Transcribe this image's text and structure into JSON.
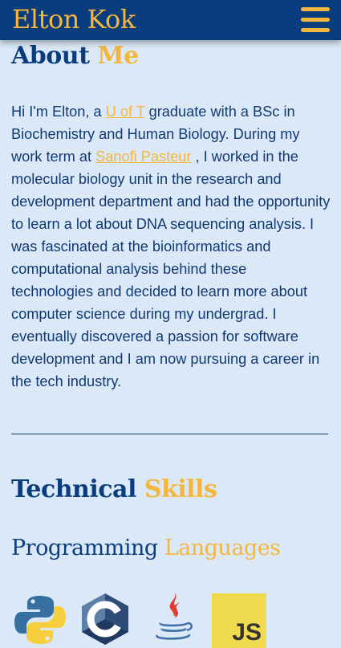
{
  "navbar": {
    "brand": "Elton Kok",
    "menu_icon": "hamburger-menu-icon"
  },
  "about": {
    "heading_main": "About",
    "heading_accent": "Me",
    "text_before_uoft": "Hi I'm Elton, a ",
    "uoft_link": "U of T",
    "text_after_uoft": " graduate with a BSc in Biochemistry and Human Biology. During my work term at ",
    "sanofi_link": "Sanofi Pasteur",
    "text_after_sanofi": " , I worked in the molecular biology unit in the research and development department and had the opportunity to learn a lot about DNA sequencing analysis. I was fascinated at the bioinformatics and computational analysis behind these technologies and decided to learn more about computer science during my undergrad. I eventually discovered a passion for software development and I am now pursuing a career in the tech industry."
  },
  "skills": {
    "heading_main": "Technical",
    "heading_accent": "Skills",
    "languages": {
      "heading_main": "Programming",
      "heading_accent": "Languages",
      "icons": [
        "python-icon",
        "c-language-icon",
        "java-icon",
        "javascript-icon"
      ],
      "js_badge_text": "JS"
    }
  },
  "colors": {
    "navy": "#0a3d7e",
    "gold": "#f4b73c",
    "background": "#dbe8f8"
  }
}
